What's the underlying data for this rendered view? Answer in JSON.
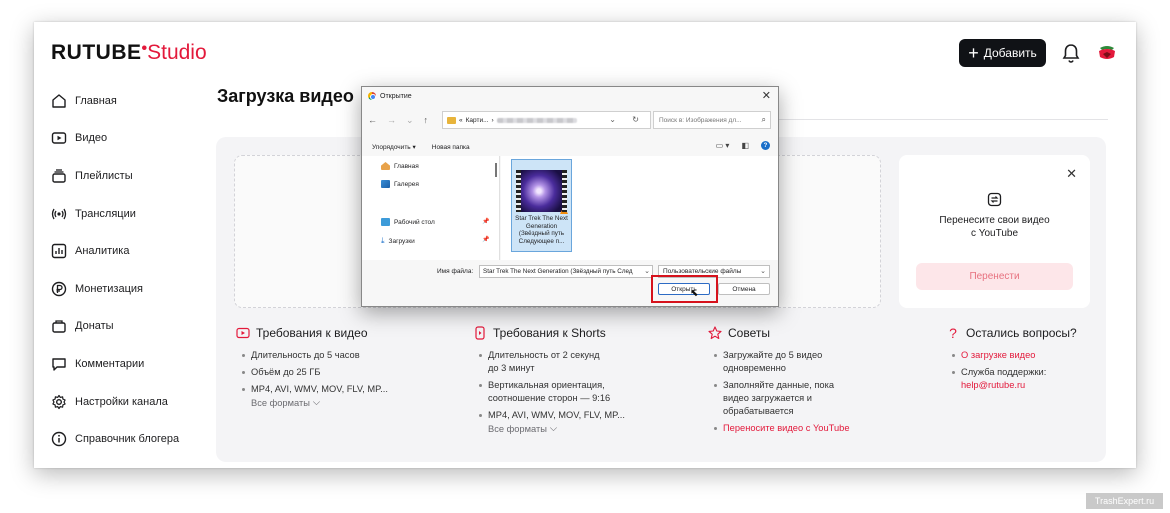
{
  "header": {
    "logo_primary": "RUTUBE",
    "logo_secondary": "Studio",
    "add_button_label": "Добавить",
    "brand_color": "#e3193b",
    "bell_icon": "bell-icon",
    "avatar_icon": "avatar"
  },
  "sidebar": {
    "items": [
      {
        "label": "Главная",
        "icon": "home-icon"
      },
      {
        "label": "Видео",
        "icon": "video-icon"
      },
      {
        "label": "Плейлисты",
        "icon": "playlist-icon"
      },
      {
        "label": "Трансляции",
        "icon": "broadcast-icon"
      },
      {
        "label": "Аналитика",
        "icon": "analytics-icon"
      },
      {
        "label": "Монетизация",
        "icon": "ruble-icon"
      },
      {
        "label": "Донаты",
        "icon": "donation-icon"
      },
      {
        "label": "Комментарии",
        "icon": "comment-icon"
      },
      {
        "label": "Настройки канала",
        "icon": "gear-icon"
      },
      {
        "label": "Справочник блогера",
        "icon": "info-icon"
      }
    ]
  },
  "main": {
    "page_title": "Загрузка видео",
    "transfer_card": {
      "text_line1": "Перенесите свои видео",
      "text_line2": "с YouTube",
      "button_label": "Перенести"
    },
    "requirements": [
      {
        "title": "Требования к видео",
        "items": [
          "Длительность до 5 часов",
          "Объём до 25 ГБ",
          "MP4, AVI, WMV, MOV, FLV, MP..."
        ],
        "more": "Все форматы"
      },
      {
        "title": "Требования к Shorts",
        "items": [
          "Длительность от 2 секунд до 3 минут",
          "Вертикальная ориентация, соотношение сторон — 9:16",
          "MP4, AVI, WMV, MOV, FLV, MP..."
        ],
        "more": "Все форматы"
      },
      {
        "title": "Советы",
        "items": [
          "Загружайте до 5 видео одновременно",
          "Заполняйте данные, пока видео загружается и обрабатывается",
          "Переносите видео с YouTube"
        ]
      },
      {
        "title": "Остались вопросы?",
        "items": [
          "О загрузке видео",
          "Служба поддержки:"
        ],
        "email": "help@rutube.ru"
      }
    ]
  },
  "dialog": {
    "title": "Открытие",
    "path_prefix": "«",
    "path_folder": "Карти...",
    "search_placeholder": "Поиск в: Изображения дл...",
    "toolbar": {
      "organize": "Упорядочить",
      "new_folder": "Новая папка"
    },
    "nav_items": [
      {
        "label": "Главная",
        "icon": "home-icon"
      },
      {
        "label": "Галерея",
        "icon": "gallery-icon"
      },
      {
        "label": "Рабочий стол",
        "icon": "desktop-icon"
      },
      {
        "label": "Загрузки",
        "icon": "download-icon"
      }
    ],
    "file": {
      "name": "Star Trek The Next Generation (Звёздный путь Следующее п..."
    },
    "filename_label": "Имя файла:",
    "filename_value": "Star Trek The Next Generation (Звёздный путь След",
    "filetype_value": "Пользовательские файлы",
    "open_button": "Открыть",
    "cancel_button": "Отмена"
  },
  "watermark": "TrashExpert.ru"
}
